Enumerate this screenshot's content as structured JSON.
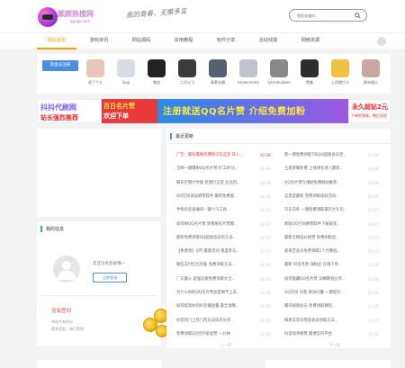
{
  "header": {
    "logo_text": "颜颜热搜网",
    "logo_sub": "qqxgo.com",
    "slogan": "我的青春，无需多言",
    "search_placeholder": "搜索关键词..."
  },
  "nav": {
    "items": [
      "网站首页",
      "游戏资讯",
      "网站源码",
      "实用教程",
      "软件分享",
      "活动线报",
      "网络资源"
    ],
    "active_index": 0
  },
  "users": {
    "new_label": "新会员注册",
    "list": [
      {
        "name": "虎了个大",
        "color": "#e8c7b8"
      },
      {
        "name": "Bug",
        "color": "#d9dce4"
      },
      {
        "name": "微笑",
        "color": "#222222"
      },
      {
        "name": "二月与飞",
        "color": "#3a3a3a"
      },
      {
        "name": "青葱年嫩",
        "color": "#556070"
      },
      {
        "name": "brokenmelo",
        "color": "#bfc4cc"
      },
      {
        "name": "tylerdoublen",
        "color": "#888888"
      },
      {
        "name": "赞美",
        "color": "#2c2c2c"
      },
      {
        "name": "上班就打卡",
        "color": "#f0c040"
      },
      {
        "name": "那年烟火",
        "color": "#c8a8a0"
      }
    ]
  },
  "banners": {
    "b1_line1": "抖抖代刷网",
    "b1_line2": "站长强烈推荐",
    "b2_line1": "百日名片赞",
    "b2_line2": "欢迎下单",
    "b3_line1": "注册就送QQ名片赞  介绍免费加粉",
    "b4_line1": "永久超钻2元",
    "b4_line2": "下单秒到账，售后无忧"
  },
  "user_panel": {
    "title": "我的信息",
    "not_logged": "您还没有登录哦~",
    "login_button": "立即登录",
    "checkin": "没有签到",
    "detail1": "本站共有积分",
    "detail2": "签到奖励：每日签到"
  },
  "news": {
    "title": "最近更新",
    "left": [
      {
        "title": "广告：最有需要的爆款尽在这里 日入..",
        "date": "02-28",
        "hot": true
      },
      {
        "title": "全网一键爆刷QQ名片赞 打工网 比..",
        "date": "02-28",
        "hot": false
      },
      {
        "title": "聊天打倒计时版 给我们这里 比任何..",
        "date": "02-28",
        "hot": false
      },
      {
        "title": "QQ空间说说刷赞软件 最新免费版..",
        "date": "02-28",
        "hot": false
      },
      {
        "title": "手机抖音直播间一键人气工具..",
        "date": "02-27",
        "hot": false
      },
      {
        "title": "如何刷QQ名片赞 免费刷名片赞教..",
        "date": "02-27",
        "hot": false
      },
      {
        "title": "最新免费领取QQ超级会员的方法..",
        "date": "02-27",
        "hot": false
      },
      {
        "title": "【免费领】Q币 最新活动 速度参与..",
        "date": "02-27",
        "hot": false
      },
      {
        "title": "微信支付红包封面 免费领取方法..",
        "date": "02-26",
        "hot": false
      },
      {
        "title": "广东最火 超强功能免费领取大全..",
        "date": "02-26",
        "hot": false
      },
      {
        "title": "为什么你的QQ名片赞总是刷不上去..",
        "date": "02-26",
        "hot": false
      },
      {
        "title": "如何提高你的抖音播放量 最全攻略..",
        "date": "02-25",
        "hot": false
      },
      {
        "title": "抖音热门上热门的方法技巧分享..",
        "date": "02-25",
        "hot": false
      },
      {
        "title": "免费领取QQ空间说说赞 一分钟..",
        "date": "02-25",
        "hot": false
      }
    ],
    "right": [
      {
        "title": "新一期免费领取7天QQ超级会员活..",
        "date": "02-28",
        "hot": false
      },
      {
        "title": "王者荣耀免费 上线领先进入最新..",
        "date": "02-28",
        "hot": false
      },
      {
        "title": "QQ名片赞在线刷免费网站推荐..",
        "date": "02-28",
        "hot": false
      },
      {
        "title": "这里是最新 免费领取皮肤活动..",
        "date": "02-28",
        "hot": false
      },
      {
        "title": "京东白条 一键免费领取豪华大礼包..",
        "date": "02-27",
        "hot": false
      },
      {
        "title": "新版QQ空间刷赞软件下载安装..",
        "date": "02-27",
        "hot": false
      },
      {
        "title": "最新全网低价刷赞 免费刷粉丝..",
        "date": "02-27",
        "hot": false
      },
      {
        "title": "爱奇艺会员免费领取1个月教程..",
        "date": "02-27",
        "hot": false
      },
      {
        "title": "最新 抖音点赞 涨粉丝 在线下单..",
        "date": "02-26",
        "hot": false
      },
      {
        "title": "如何隐藏QQ名片赞 详细教程分享..",
        "date": "02-26",
        "hot": false
      },
      {
        "title": "QQ空间 访客 刷访问量 一键提升..",
        "date": "02-26",
        "hot": false
      },
      {
        "title": "腾讯视频会员 免费领取教程..",
        "date": "02-25",
        "hot": false
      },
      {
        "title": "网易云音乐黑胶会员领取方法..",
        "date": "02-25",
        "hot": false
      },
      {
        "title": "抖音快手刷赞 最便宜的平台..",
        "date": "02-25",
        "hot": false
      }
    ],
    "prev": "上一页",
    "next": "下一页"
  }
}
